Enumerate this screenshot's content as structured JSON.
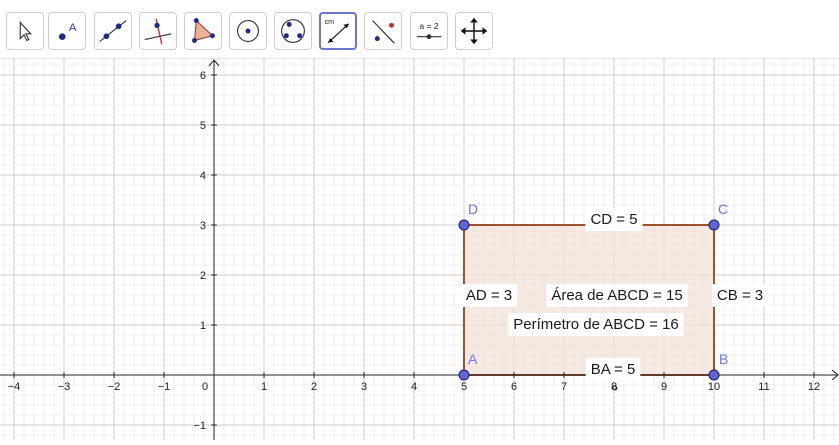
{
  "toolbar": {
    "tools": [
      {
        "id": "move",
        "icon": "move-arrow-icon"
      },
      {
        "id": "point",
        "icon": "point-icon",
        "label": "A"
      },
      {
        "id": "line",
        "icon": "line-icon"
      },
      {
        "id": "perpendicular",
        "icon": "perpendicular-line-icon"
      },
      {
        "id": "polygon",
        "icon": "polygon-icon"
      },
      {
        "id": "circle-center",
        "icon": "circle-center-point-icon"
      },
      {
        "id": "circle-three-points",
        "icon": "circle-three-points-icon"
      },
      {
        "id": "distance",
        "icon": "distance-length-icon",
        "label": "cm",
        "selected": true
      },
      {
        "id": "reflect",
        "icon": "reflect-about-line-icon"
      },
      {
        "id": "slider",
        "icon": "slider-icon",
        "label": "a = 2"
      },
      {
        "id": "move-view",
        "icon": "move-graphics-view-icon"
      }
    ]
  },
  "graphics": {
    "x_axis": {
      "ticks": [
        "−4",
        "−3",
        "−2",
        "−1",
        "0",
        "1",
        "2",
        "3",
        "4",
        "5",
        "6",
        "7",
        "8",
        "9",
        "10",
        "11",
        "12"
      ]
    },
    "y_axis": {
      "ticks": [
        "−1",
        "1",
        "2",
        "3",
        "4",
        "5",
        "6"
      ]
    },
    "points": [
      {
        "name": "A",
        "x": 5,
        "y": 0
      },
      {
        "name": "B",
        "x": 10,
        "y": 0
      },
      {
        "name": "C",
        "x": 10,
        "y": 3
      },
      {
        "name": "D",
        "x": 5,
        "y": 3
      }
    ],
    "labels": {
      "cd": "CD = 5",
      "ad": "AD = 3",
      "cb": "CB = 3",
      "ba": "BA = 5",
      "area": "Área de  ABCD = 15",
      "perimeter": "Perímetro de  ABCD = 16"
    },
    "colors": {
      "polygon_stroke": "#a0522d",
      "polygon_fill": "#f2dfd6",
      "point_fill": "#5e66d6",
      "point_label": "#6d74e0",
      "grid_major": "#cfcfcf",
      "grid_minor": "#ececec",
      "selected_tool_border": "#6b77c9"
    }
  }
}
